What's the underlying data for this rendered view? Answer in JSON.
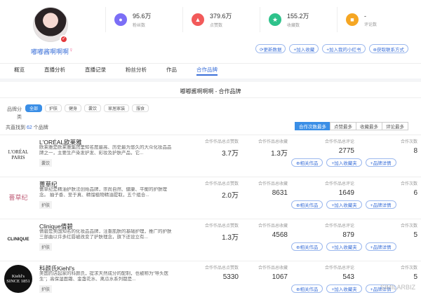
{
  "profile": {
    "nickname": "嘟嘟酱啊啊啊",
    "gender_symbol": "♀",
    "verified_icon": "check-badge-icon"
  },
  "stats": [
    {
      "value": "95.6万",
      "label": "粉丝数",
      "icon": "user-icon",
      "color": "#7b6ef6"
    },
    {
      "value": "379.6万",
      "label": "点赞数",
      "icon": "thumb-icon",
      "color": "#f25a5a"
    },
    {
      "value": "155.2万",
      "label": "收藏数",
      "icon": "star-icon",
      "color": "#2ec28b"
    },
    {
      "value": "-",
      "label": "评论数",
      "icon": "comment-icon",
      "color": "#f5a623"
    }
  ],
  "actions": [
    "⟳更新数据",
    "+加入收藏",
    "+加入我的小红书",
    "⊕获取联系方式"
  ],
  "tabs": [
    {
      "label": "概览",
      "active": false
    },
    {
      "label": "直播分析",
      "active": false
    },
    {
      "label": "直播记录",
      "active": false
    },
    {
      "label": "粉丝分析",
      "active": false
    },
    {
      "label": "作品",
      "active": false
    },
    {
      "label": "合作品牌",
      "active": true
    }
  ],
  "main": {
    "title": "嘟嘟酱啊啊啊 - 合作品牌",
    "filter_label": "品牌分",
    "filter_label2": "类",
    "chips": [
      {
        "label": "全部",
        "active": true
      },
      {
        "label": "护肤",
        "active": false
      },
      {
        "label": "健身",
        "active": false
      },
      {
        "label": "囊饮",
        "active": false
      },
      {
        "label": "家居家装",
        "active": false
      },
      {
        "label": "服食",
        "active": false
      }
    ],
    "total_prefix": "共直找到",
    "total_count": "62",
    "total_suffix": "个品牌",
    "sort_options": [
      {
        "label": "合作次数最多",
        "active": true
      },
      {
        "label": "点赞最多",
        "active": false
      },
      {
        "label": "收藏最多",
        "active": false
      },
      {
        "label": "评论最多",
        "active": false
      }
    ],
    "metric_labels": [
      "合作作品总点赞数",
      "合作作品总收藏",
      "合作作品总评论",
      "合作次数"
    ],
    "row_buttons": [
      "⊕相关作品",
      "+加入收藏夹",
      "+品牌详情"
    ]
  },
  "brands": [
    {
      "name": "L'ORÉAL欧莱雅",
      "desc": "欧莱雅是欧莱雅集团里知名度最高、历史最为悠久的大众化妆品品牌之一，主要生产染发护发、彩妆及护肤产品，它...",
      "tag": "囊饮",
      "logo_text": "L'ORÉAL\nPARIS",
      "likes": "3.7万",
      "collects": "1.3万",
      "comments": "2775",
      "count": "8"
    },
    {
      "name": "薔草纪",
      "desc": "薔草纪是精油护肤法创始品牌，崇尚自然、健康、平衡的护肤理念。 抽子香、至于真、精馏植物精油提取，五个组合...",
      "tag": "护肤",
      "logo_text": "薔草纪",
      "likes": "2.0万",
      "collects": "8631",
      "comments": "1649",
      "count": "6"
    },
    {
      "name": "Clinique倩碧",
      "desc": "倩碧是美国知名的化妆品品牌，注重肌肤的基础护理，推广的护肤三部曲以许多红唇被改变了护肤理念，旗下还设立有...",
      "tag": "护肤",
      "logo_text": "CLINIQUE",
      "likes": "1.3万",
      "collects": "4568",
      "comments": "879",
      "count": "5"
    },
    {
      "name": "科颜氏Kiehl's",
      "desc": "美国药店起家的科颜氏，提求天然成分的配制，也被称为“导头医生”；高保湿面霜、金盏花水、离瓜水系列都是...",
      "tag": "护肤",
      "logo_text": "Kiehl's\nSINCE 1851",
      "likes": "5330",
      "collects": "1067",
      "comments": "543",
      "count": "5"
    }
  ],
  "watermark": "SIMILARBIZ"
}
